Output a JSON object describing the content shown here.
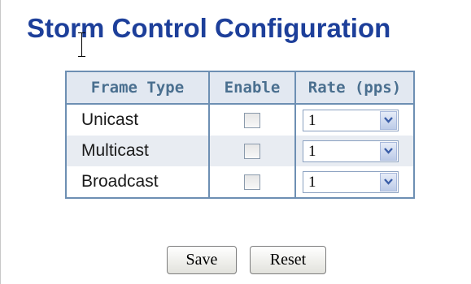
{
  "page": {
    "title": "Storm Control Configuration"
  },
  "table": {
    "headers": {
      "frame_type": "Frame Type",
      "enable": "Enable",
      "rate": "Rate (pps)"
    },
    "rows": [
      {
        "frame_type": "Unicast",
        "enabled": false,
        "rate": "1"
      },
      {
        "frame_type": "Multicast",
        "enabled": false,
        "rate": "1"
      },
      {
        "frame_type": "Broadcast",
        "enabled": false,
        "rate": "1"
      }
    ]
  },
  "buttons": {
    "save": "Save",
    "reset": "Reset"
  },
  "colors": {
    "title": "#1d3f9a",
    "header_bg": "#e2e8f1",
    "header_text": "#4a6f8f",
    "table_border": "#6d8fb3",
    "alt_row_bg": "#e8ecf2"
  },
  "icons": {
    "dropdown": "chevron-down-icon",
    "cursor": "text-cursor-icon"
  }
}
